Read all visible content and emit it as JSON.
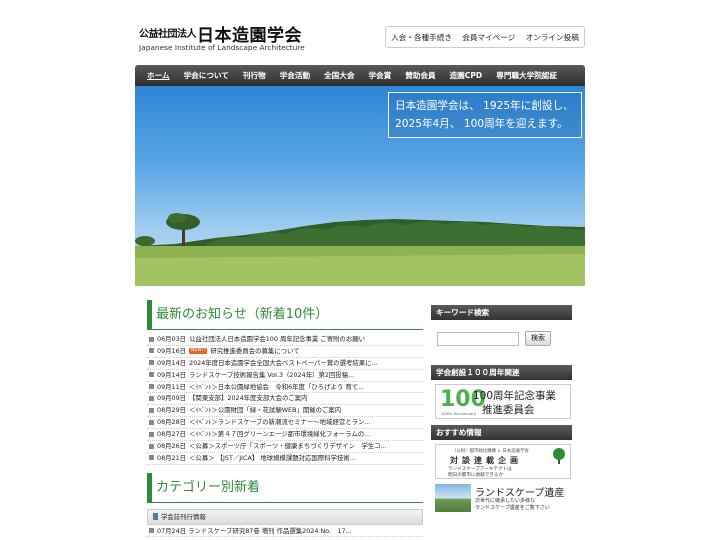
{
  "header": {
    "org_type": "公益社団法人",
    "org_name": "日本造園学会",
    "org_name_en": "Japanese Institute of Landscape Architecture",
    "top_links": [
      "入会・各種手続き",
      "会員マイページ",
      "オンライン投稿"
    ]
  },
  "nav": {
    "items": [
      "ホーム",
      "学会について",
      "刊行物",
      "学会活動",
      "全国大会",
      "学会賞",
      "賛助会員",
      "造園CPD",
      "専門職大学院認証"
    ],
    "active_index": 0
  },
  "hero": {
    "message_line1": "日本造園学会は、 1925年に創設し、",
    "message_line2": "2025年4月、 100周年を迎えます。"
  },
  "news": {
    "title": "最新のお知らせ（新着10件）",
    "new_badge": "NEW!!",
    "items": [
      {
        "date": "06月03日",
        "text": "公益社団法人日本造園学会100 周年記念事業 ご寄附のお願い",
        "is_new": false
      },
      {
        "date": "09月16日",
        "text": "研究推進委員会の募集について",
        "is_new": true
      },
      {
        "date": "09月14日",
        "text": "2024年度日本造園学会全国大会ベストペーパー賞の選考結果に...",
        "is_new": false
      },
      {
        "date": "09月14日",
        "text": "ランドスケープ技術報告集 Vol.3（2024年）第2回投稿...",
        "is_new": false
      },
      {
        "date": "09月11日",
        "text": "＜ｲﾍﾞﾝﾄ＞日本公園緑地協会　令和6年度「ひろげよう 育て...",
        "is_new": false
      },
      {
        "date": "09月09日",
        "text": "【関東支部】2024年度支部大会のご案内",
        "is_new": false
      },
      {
        "date": "08月29日",
        "text": "＜ｲﾍﾞﾝﾄ＞公園財団「緑・花試験WEB」開催のご案内",
        "is_new": false
      },
      {
        "date": "08月28日",
        "text": "＜ｲﾍﾞﾝﾄ＞ランドスケープの新潮流セミナー～地域経営とラン...",
        "is_new": false
      },
      {
        "date": "08月27日",
        "text": "＜ｲﾍﾞﾝﾄ＞第４７回グリーンエージ都市環境緑化フォーラムの...",
        "is_new": false
      },
      {
        "date": "08月26日",
        "text": "＜公募＞スポーツ庁「スポーツ・健康まちづくりデザイン　学生コ...",
        "is_new": false
      },
      {
        "date": "08月21日",
        "text": "＜公募＞ 【JST／JICA】 地球規模課題対応国際科学技術...",
        "is_new": false
      }
    ]
  },
  "category": {
    "title": "カテゴリー別新着",
    "section_label": "学会誌刊行情報",
    "items": [
      {
        "date": "07月24日",
        "text": "ランドスケープ研究87巻 増刊 作品選集2024 No.　17..."
      }
    ]
  },
  "sidebar": {
    "keyword_title": "キーワード検索",
    "search_placeholder": "",
    "search_button": "検索",
    "anniversary_title": "学会創設１００周年関連",
    "anniversary_big": "100",
    "anniversary_small": "100th Anniversary",
    "anniversary_line1": "100周年記念事業",
    "anniversary_line2": "推進委員会",
    "recommend_title": "おすすめ情報",
    "rensai_line1": "（公財）都市緑化機構 × 日本造園学会",
    "rensai_line2": "対談連載企画",
    "rensai_line3": "ランドスケープアーキテクトは",
    "rensai_line4": "明日の都市に貢献できるか",
    "isan_title": "ランドスケープ遺産",
    "isan_sub1": "次世代に継承したい多様な",
    "isan_sub2": "ランドスケープ遺産をご覧下さい"
  },
  "colors": {
    "accent_green": "#2f8a3a",
    "nav_dark": "#333333",
    "new_badge": "#e8662d"
  }
}
